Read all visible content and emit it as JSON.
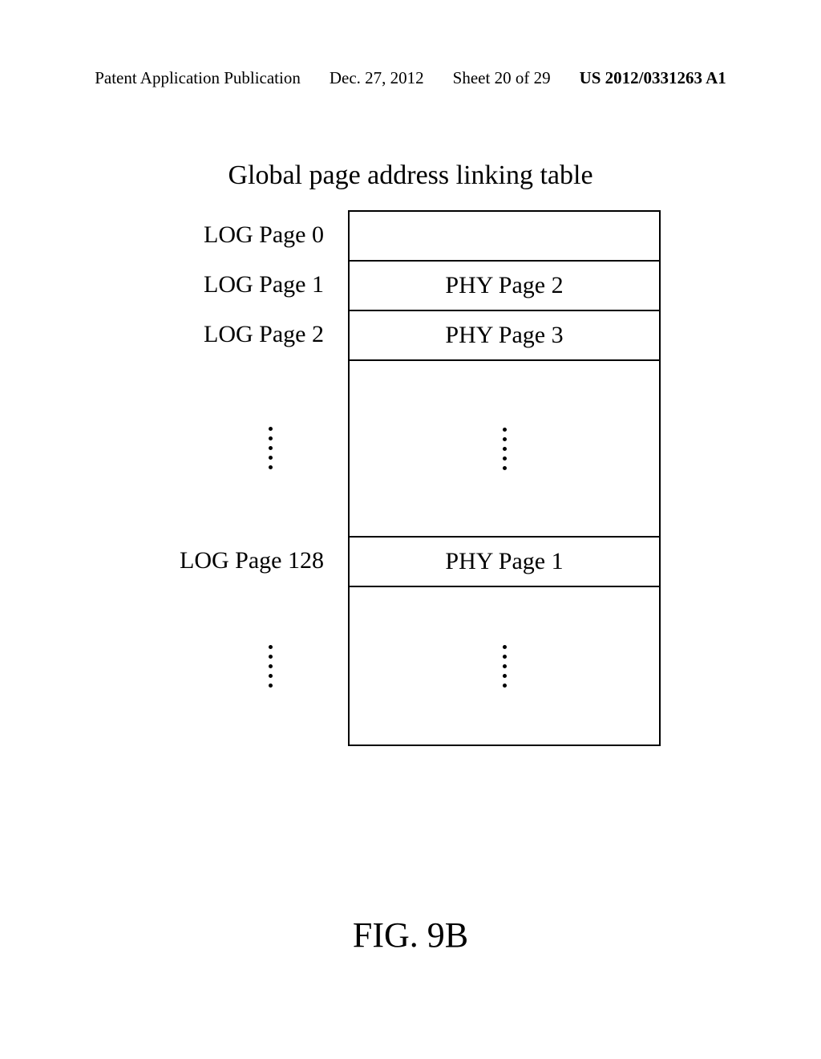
{
  "header": {
    "left": "Patent Application Publication",
    "date": "Dec. 27, 2012",
    "sheet": "Sheet 20 of 29",
    "pub": "US 2012/0331263 A1"
  },
  "title": "Global page address linking table",
  "rows": {
    "r0_log": "LOG Page 0",
    "r0_phy": "",
    "r1_log": "LOG Page 1",
    "r1_phy": "PHY Page 2",
    "r2_log": "LOG Page 2",
    "r2_phy": "PHY Page 3",
    "r3_log": "LOG Page 128",
    "r3_phy": "PHY Page 1"
  },
  "figure_label": "FIG. 9B"
}
